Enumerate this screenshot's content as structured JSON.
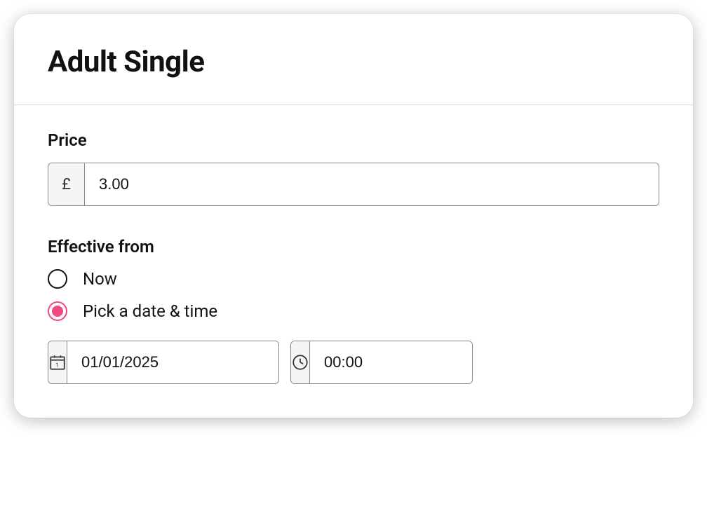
{
  "header": {
    "title": "Adult Single"
  },
  "price": {
    "label": "Price",
    "currency_symbol": "£",
    "value": "3.00"
  },
  "effective": {
    "label": "Effective from",
    "options": {
      "now": "Now",
      "pick": "Pick a date & time"
    },
    "selected": "pick",
    "date_value": "01/01/2025",
    "time_value": "00:00"
  },
  "colors": {
    "accent": "#ef4a81"
  }
}
